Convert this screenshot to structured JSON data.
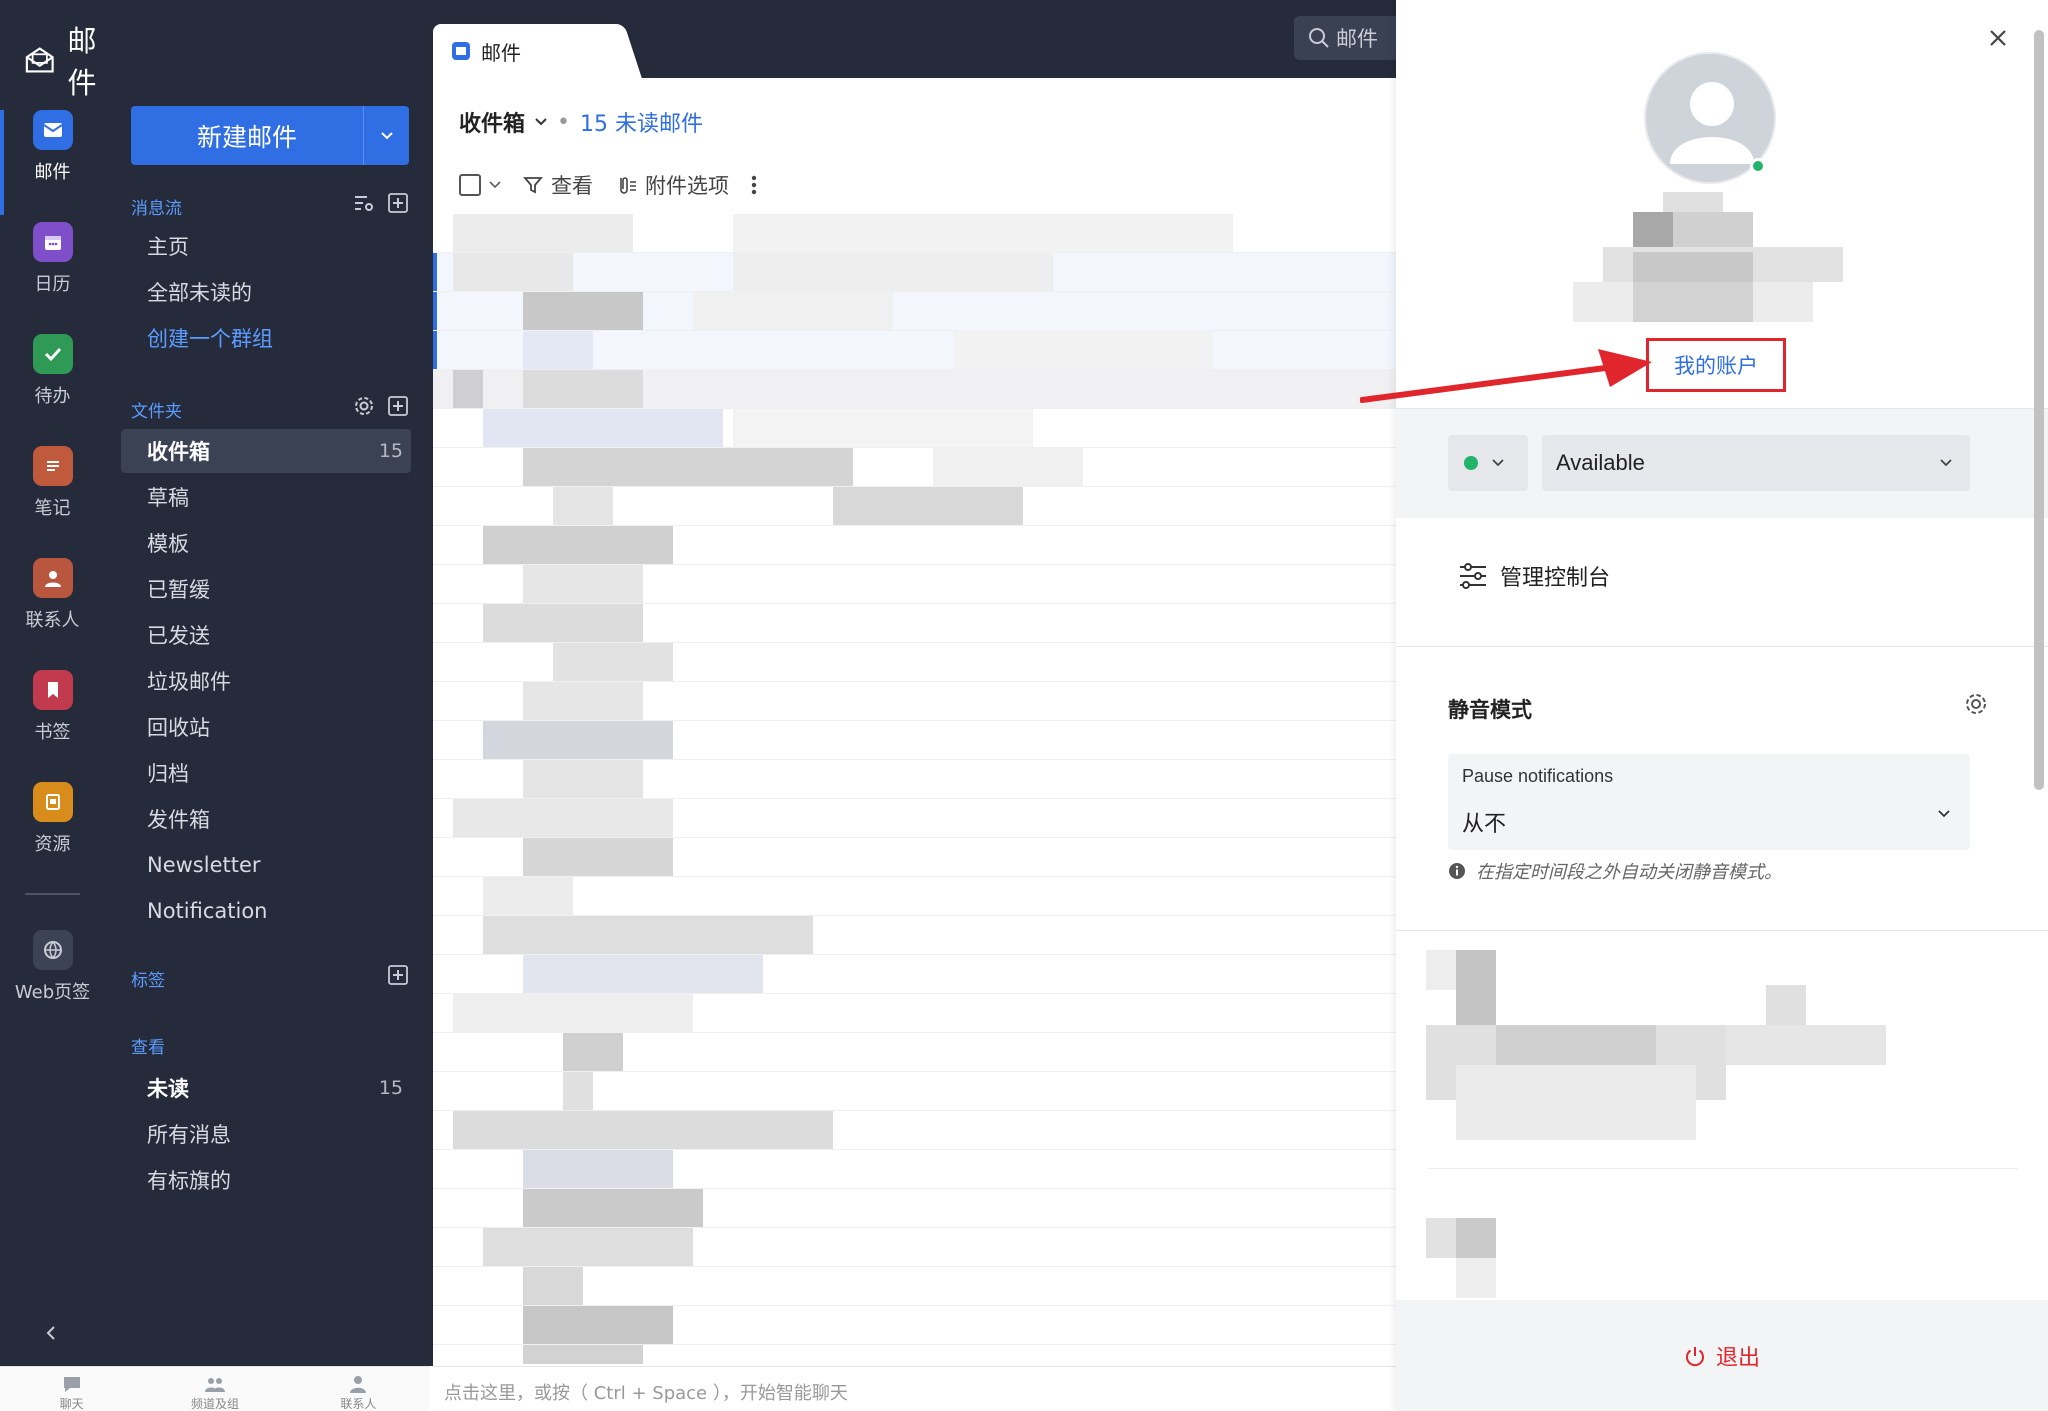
{
  "app": {
    "title": "邮件"
  },
  "rail": [
    {
      "label": "邮件",
      "icon": "mail-icon",
      "color": "#2f6ee3"
    },
    {
      "label": "日历",
      "icon": "calendar-icon",
      "color": "#7f4fc9"
    },
    {
      "label": "待办",
      "icon": "check-icon",
      "color": "#2e9a55"
    },
    {
      "label": "笔记",
      "icon": "note-icon",
      "color": "#c05a3c"
    },
    {
      "label": "联系人",
      "icon": "contact-icon",
      "color": "#b8563e"
    },
    {
      "label": "书签",
      "icon": "bookmark-icon",
      "color": "#c23a4d"
    },
    {
      "label": "资源",
      "icon": "resource-icon",
      "color": "#d78c1b"
    },
    {
      "label": "Web页签",
      "icon": "web-icon",
      "color": "#3c4354"
    }
  ],
  "compose": {
    "label": "新建邮件"
  },
  "stream": {
    "heading": "消息流",
    "items": [
      "主页",
      "全部未读的",
      "创建一个群组"
    ]
  },
  "folders": {
    "heading": "文件夹",
    "items": [
      {
        "label": "收件箱",
        "count": "15"
      },
      {
        "label": "草稿"
      },
      {
        "label": "模板"
      },
      {
        "label": "已暂缓"
      },
      {
        "label": "已发送"
      },
      {
        "label": "垃圾邮件"
      },
      {
        "label": "回收站"
      },
      {
        "label": "归档"
      },
      {
        "label": "发件箱"
      },
      {
        "label": "Newsletter"
      },
      {
        "label": "Notification"
      }
    ]
  },
  "tags": {
    "heading": "标签"
  },
  "views": {
    "heading": "查看",
    "items": [
      {
        "label": "未读",
        "count": "15"
      },
      {
        "label": "所有消息"
      },
      {
        "label": "有标旗的"
      }
    ]
  },
  "bottom_nav": [
    "聊天",
    "频道及组",
    "联系人"
  ],
  "chat_input": {
    "placeholder": "点击这里，或按（ Ctrl + Space ），开始智能聊天"
  },
  "tab": {
    "label": "邮件"
  },
  "search": {
    "placeholder": "邮件"
  },
  "inbox": {
    "name": "收件箱",
    "unread": "15 未读邮件",
    "toolbar": {
      "view": "查看",
      "attachments": "附件选项"
    }
  },
  "profile": {
    "my_account": "我的账户",
    "status": "Available",
    "admin_console": "管理控制台",
    "dnd": {
      "heading": "静音模式",
      "pause_label": "Pause notifications",
      "pause_value": "从不",
      "hint": "在指定时间段之外自动关闭静音模式。"
    },
    "logout": "退出"
  },
  "colors": {
    "accent": "#2f6ee3",
    "sidebar": "#252b3a",
    "highlight": "#e0262c",
    "online": "#21b46a"
  }
}
